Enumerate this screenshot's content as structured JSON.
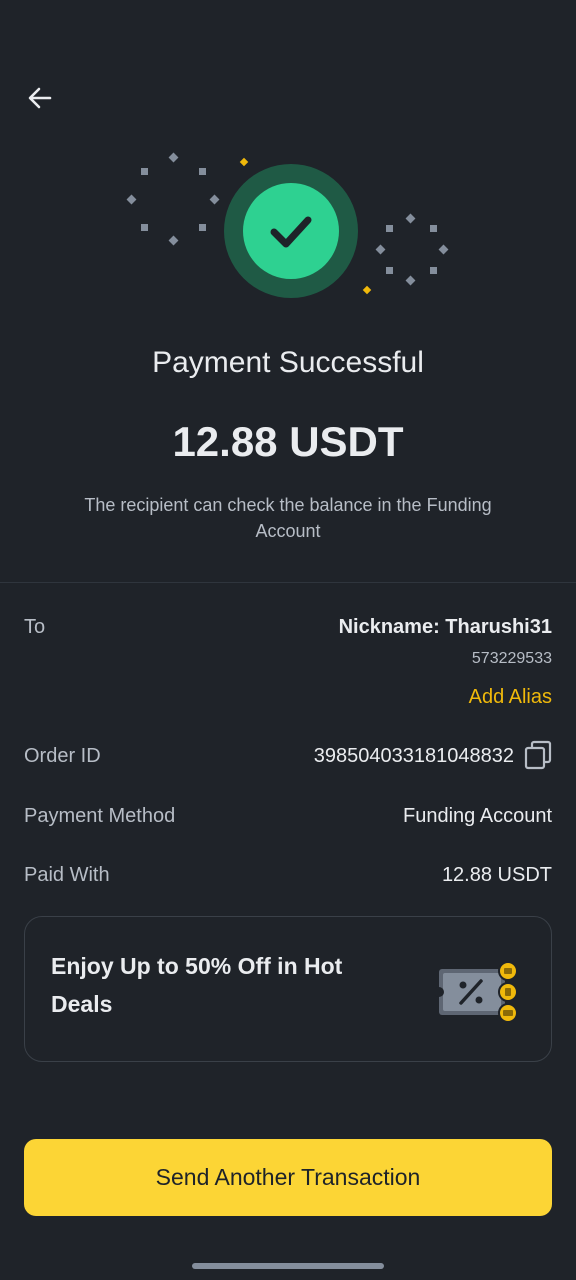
{
  "header": {
    "back_icon": "arrow-left-icon"
  },
  "status": {
    "icon": "success-check-icon",
    "title": "Payment Successful",
    "amount": "12.88 USDT",
    "subtitle": "The recipient can check the balance in the Funding Account",
    "colors": {
      "success": "#2ed191",
      "success_ring": "#1f5a45",
      "accent": "#f0b90b"
    }
  },
  "details": {
    "to": {
      "label": "To",
      "nickname": "Nickname: Tharushi31",
      "uid": "573229533",
      "alias_link": "Add Alias"
    },
    "order_id": {
      "label": "Order ID",
      "value": "398504033181048832",
      "copy_icon": "copy-icon"
    },
    "payment_method": {
      "label": "Payment Method",
      "value": "Funding Account"
    },
    "paid_with": {
      "label": "Paid With",
      "value": "12.88 USDT"
    }
  },
  "promo": {
    "text": "Enjoy Up to 50% Off in Hot Deals",
    "icon": "discount-ticket-icon"
  },
  "cta": {
    "label": "Send Another Transaction",
    "color": "#fcd535"
  }
}
